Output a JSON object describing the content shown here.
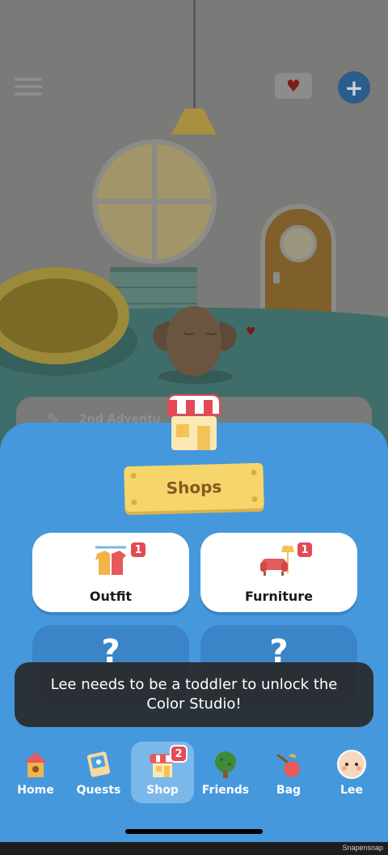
{
  "room": {
    "adventure_card_text": "2nd Adventu",
    "mail_icon": "envelope-heart-icon",
    "add_icon": "plus-icon",
    "menu_icon": "hamburger-menu-icon"
  },
  "shop_panel": {
    "title": "Shops",
    "cards": [
      {
        "label": "Outfit",
        "badge": "1",
        "icon": "clothes-rack-icon"
      },
      {
        "label": "Furniture",
        "badge": "1",
        "icon": "sofa-lamp-icon"
      }
    ],
    "locked": [
      {
        "label": "?"
      },
      {
        "label": "?"
      }
    ]
  },
  "toast": {
    "message": "Lee needs to be a toddler to unlock the Color Studio!"
  },
  "bottom_nav": {
    "items": [
      {
        "label": "Home",
        "icon": "birdhouse-icon",
        "active": false
      },
      {
        "label": "Quests",
        "icon": "quest-card-icon",
        "active": false
      },
      {
        "label": "Shop",
        "icon": "shop-icon",
        "active": true,
        "badge": "2"
      },
      {
        "label": "Friends",
        "icon": "tree-icon",
        "active": false
      },
      {
        "label": "Bag",
        "icon": "bag-icon",
        "active": false
      },
      {
        "label": "Lee",
        "icon": "baby-face-icon",
        "active": false
      }
    ]
  },
  "watermark": "Snapensnap",
  "colors": {
    "panel_blue": "#4698dc",
    "plate_yellow": "#f6d66a",
    "badge_red": "#e44a55"
  }
}
